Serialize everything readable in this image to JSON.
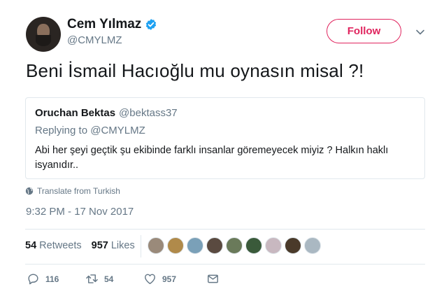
{
  "author": {
    "display_name": "Cem Yılmaz",
    "handle": "@CMYLMZ",
    "verified": true,
    "avatar_icon": "user-avatar"
  },
  "header": {
    "follow_label": "Follow",
    "caret_icon": "chevron-down-icon"
  },
  "tweet": {
    "text": "Beni İsmail Hacıoğlu mu oynasın misal ?!",
    "timestamp": "9:32 PM - 17 Nov 2017",
    "translate_label": "Translate from Turkish"
  },
  "quoted": {
    "name": "Oruchan Bektas",
    "handle": "@bektass37",
    "replying_prefix": "Replying to",
    "replying_handle": "@CMYLMZ",
    "text": "Abi her şeyi geçtik şu ekibinde farklı insanlar göremeyecek miyiz ? Halkın haklı isyanıdır.."
  },
  "stats": {
    "retweets_count": "54",
    "retweets_label": "Retweets",
    "likes_count": "957",
    "likes_label": "Likes"
  },
  "liker_avatars": [
    "#9a8a7a",
    "#b08a4a",
    "#7aa0b8",
    "#5a4a40",
    "#6a7a5a",
    "#3a5a3a",
    "#c8b8c0",
    "#4a3a2a",
    "#aab8c2"
  ],
  "actions": {
    "reply_count": "116",
    "retweet_count": "54",
    "like_count": "957"
  },
  "colors": {
    "accent": "#e0245e",
    "verified": "#1da1f2",
    "secondary_text": "#657786",
    "border": "#e1e8ed"
  }
}
